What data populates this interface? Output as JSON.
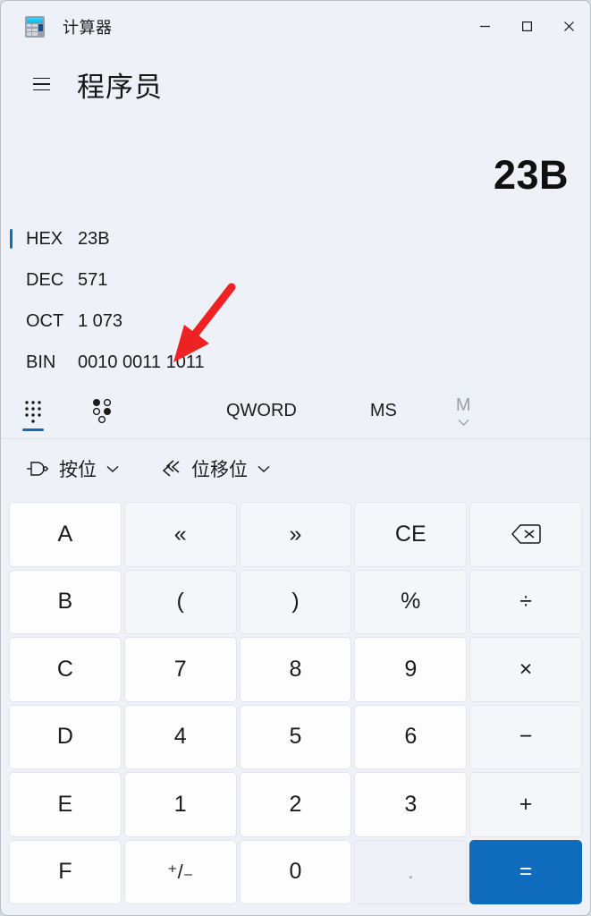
{
  "window": {
    "title": "计算器",
    "app_icon": "calculator-icon",
    "caption": {
      "minimize": "−",
      "maximize": "□",
      "close": "✕"
    }
  },
  "header": {
    "menu_icon": "hamburger-menu-icon",
    "mode_title": "程序员"
  },
  "display": {
    "result": "23B",
    "radix": [
      {
        "label": "HEX",
        "value": "23B",
        "selected": true
      },
      {
        "label": "DEC",
        "value": "571",
        "selected": false
      },
      {
        "label": "OCT",
        "value": "1 073",
        "selected": false
      },
      {
        "label": "BIN",
        "value": "0010 0011 1011",
        "selected": false
      }
    ]
  },
  "strip": {
    "keypad_icon": "keypad-dots-icon",
    "bit_toggle_icon": "bit-toggle-icon",
    "word_size": "QWORD",
    "memory_store": "MS",
    "memory_dropdown": "M",
    "memory_dropdown_caret": "⌄",
    "active_tab": "keypad"
  },
  "operators": [
    {
      "icon": "logic-gate-icon",
      "label": "按位",
      "caret": "⌄"
    },
    {
      "icon": "bit-shift-icon",
      "label": "位移位",
      "caret": "⌄"
    }
  ],
  "keypad": {
    "rows": [
      [
        {
          "label": "A",
          "kind": "hex"
        },
        {
          "label": "«",
          "kind": "op"
        },
        {
          "label": "»",
          "kind": "op"
        },
        {
          "label": "CE",
          "kind": "op"
        },
        {
          "label": "",
          "kind": "op",
          "icon": "backspace-icon"
        }
      ],
      [
        {
          "label": "B",
          "kind": "hex"
        },
        {
          "label": "(",
          "kind": "op"
        },
        {
          "label": ")",
          "kind": "op"
        },
        {
          "label": "%",
          "kind": "op"
        },
        {
          "label": "÷",
          "kind": "op"
        }
      ],
      [
        {
          "label": "C",
          "kind": "hex"
        },
        {
          "label": "7",
          "kind": "num"
        },
        {
          "label": "8",
          "kind": "num"
        },
        {
          "label": "9",
          "kind": "num"
        },
        {
          "label": "×",
          "kind": "op"
        }
      ],
      [
        {
          "label": "D",
          "kind": "hex"
        },
        {
          "label": "4",
          "kind": "num"
        },
        {
          "label": "5",
          "kind": "num"
        },
        {
          "label": "6",
          "kind": "num"
        },
        {
          "label": "−",
          "kind": "op"
        }
      ],
      [
        {
          "label": "E",
          "kind": "hex"
        },
        {
          "label": "1",
          "kind": "num"
        },
        {
          "label": "2",
          "kind": "num"
        },
        {
          "label": "3",
          "kind": "num"
        },
        {
          "label": "+",
          "kind": "op"
        }
      ],
      [
        {
          "label": "F",
          "kind": "hex"
        },
        {
          "label": "⁺/₋",
          "kind": "num"
        },
        {
          "label": "0",
          "kind": "num"
        },
        {
          "label": ".",
          "kind": "disabled"
        },
        {
          "label": "=",
          "kind": "equals"
        }
      ]
    ]
  },
  "annotation": {
    "arrow_color": "#ee2222",
    "points_at": "BIN"
  },
  "colors": {
    "accent": "#0f6cbd",
    "window_background": "#eef1f7",
    "key_background": "#f4f6fa",
    "number_key_background": "#fdfdfd",
    "text": "#1b1b1b"
  }
}
